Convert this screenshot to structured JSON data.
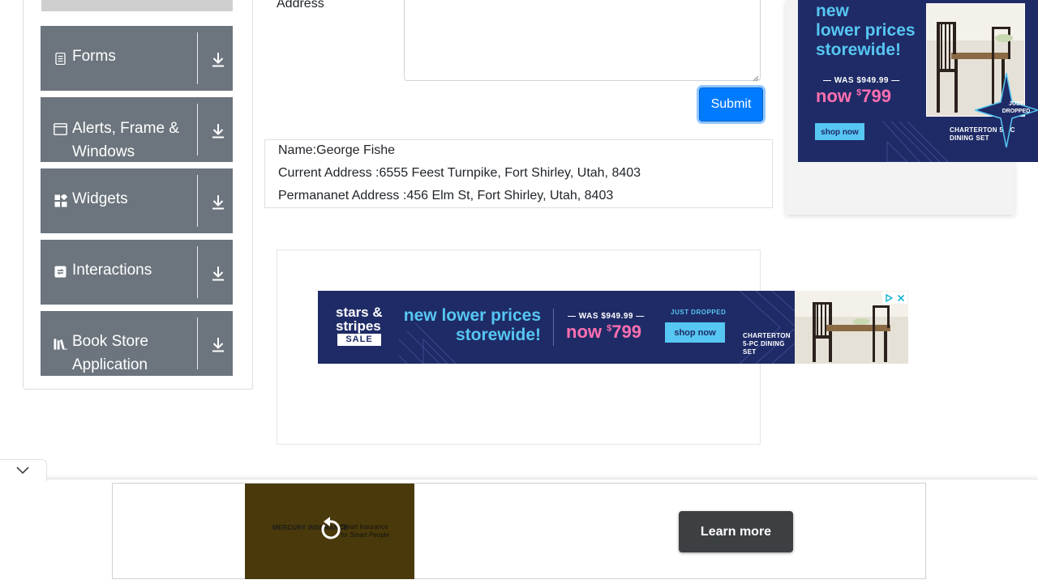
{
  "sidebar": {
    "groups": [
      {
        "label": "Forms",
        "icon": "document-icon"
      },
      {
        "label": "Alerts, Frame & Windows",
        "icon": "window-icon"
      },
      {
        "label": "Widgets",
        "icon": "widgets-icon"
      },
      {
        "label": "Interactions",
        "icon": "interactions-icon"
      },
      {
        "label": "Book Store Application",
        "icon": "books-icon"
      }
    ],
    "expand_icon": "download-arrow-icon"
  },
  "form": {
    "permanent_address_label": "Address",
    "submit_label": "Submit"
  },
  "output": {
    "name": "Name:George Fishe",
    "current_address": "Current Address :6555 Feest Turnpike, Fort Shirley, Utah, 8403",
    "permanent_address": "Permananet Address :456 Elm St, Fort Shirley, Utah, 8403"
  },
  "banner_ad": {
    "logo_line1": "stars &",
    "logo_line2": "stripes",
    "sale": "SALE",
    "headline_1": "new lower prices",
    "headline_2": "storewide!",
    "was_price": "WAS $949.99",
    "now_prefix": "now ",
    "now_super": "$",
    "now_price": "799",
    "just_dropped": "JUST DROPPED",
    "shop_label": "shop now",
    "set_name": "CHARTERTON 5-PC DINING SET"
  },
  "right_ad": {
    "headline_1": "new",
    "headline_2": "lower prices",
    "headline_3": "storewide!",
    "was_price": "WAS $949.99",
    "now_prefix": "now ",
    "now_super": "$",
    "now_price": "799",
    "shop_label": "shop now",
    "set_name": "CHARTERTON 5-PC DINING SET",
    "badge_1": "JUST",
    "badge_2": "DROPPED"
  },
  "anchor_ad": {
    "brand": "MERCURY INSURANCE",
    "tagline_1": "Smart Insurance",
    "tagline_2": "for Smart People",
    "learn_more_label": "Learn more"
  },
  "colors": {
    "group_bg": "#6c757d",
    "accent_blue": "#007bff",
    "ad_navy": "#1f2b66",
    "ad_cyan": "#56c6f2",
    "ad_pink": "#ff6fb1"
  }
}
